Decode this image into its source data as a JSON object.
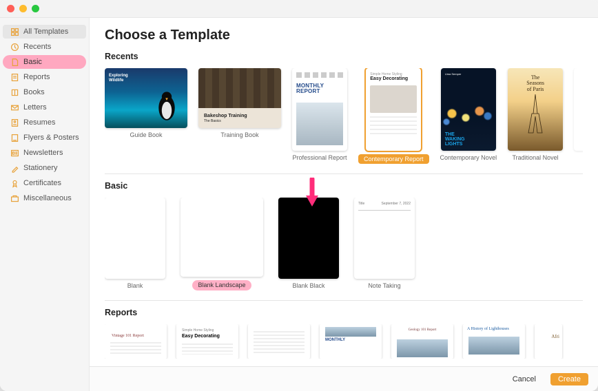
{
  "header": {
    "title": "Choose a Template"
  },
  "sidebar": {
    "items": [
      {
        "label": "All Templates",
        "icon": "grid-icon"
      },
      {
        "label": "Recents",
        "icon": "clock-icon"
      },
      {
        "label": "Basic",
        "icon": "doc-icon"
      },
      {
        "label": "Reports",
        "icon": "report-icon"
      },
      {
        "label": "Books",
        "icon": "book-icon"
      },
      {
        "label": "Letters",
        "icon": "letter-icon"
      },
      {
        "label": "Resumes",
        "icon": "resume-icon"
      },
      {
        "label": "Flyers & Posters",
        "icon": "flyer-icon"
      },
      {
        "label": "Newsletters",
        "icon": "news-icon"
      },
      {
        "label": "Stationery",
        "icon": "stationery-icon"
      },
      {
        "label": "Certificates",
        "icon": "cert-icon"
      },
      {
        "label": "Miscellaneous",
        "icon": "misc-icon"
      }
    ]
  },
  "sections": {
    "recents": {
      "title": "Recents",
      "items": [
        {
          "label": "Guide Book"
        },
        {
          "label": "Training Book"
        },
        {
          "label": "Professional Report"
        },
        {
          "label": "Contemporary Report"
        },
        {
          "label": "Contemporary Novel"
        },
        {
          "label": "Traditional Novel"
        }
      ]
    },
    "basic": {
      "title": "Basic",
      "items": [
        {
          "label": "Blank"
        },
        {
          "label": "Blank Landscape"
        },
        {
          "label": "Blank Black"
        },
        {
          "label": "Note Taking"
        }
      ]
    },
    "reports": {
      "title": "Reports"
    }
  },
  "thumb_text": {
    "guide_l1": "Exploring",
    "guide_l2": "Wildlife",
    "bake_l1": "Bakeshop Training",
    "bake_l2": "The Basics",
    "monthly_l1": "MONTHLY",
    "monthly_l2": "REPORT",
    "deco_pre": "Simple Home Styling",
    "deco_title": "Easy Decorating",
    "waking_author": "Uma Semper",
    "waking_l1": "THE",
    "waking_l2": "WAKING",
    "waking_l3": "LIGHTS",
    "paris_l1": "The",
    "paris_l2": "Seasons",
    "paris_l3": "of Paris",
    "note_hdr_left": "Title",
    "note_hdr_right": "September 7, 2022",
    "vintage": "Vintage 101 Report",
    "history": "A History of Lighthouses",
    "geology": "Geology 101 Report",
    "africa": "Afri"
  },
  "footer": {
    "cancel": "Cancel",
    "create": "Create"
  }
}
